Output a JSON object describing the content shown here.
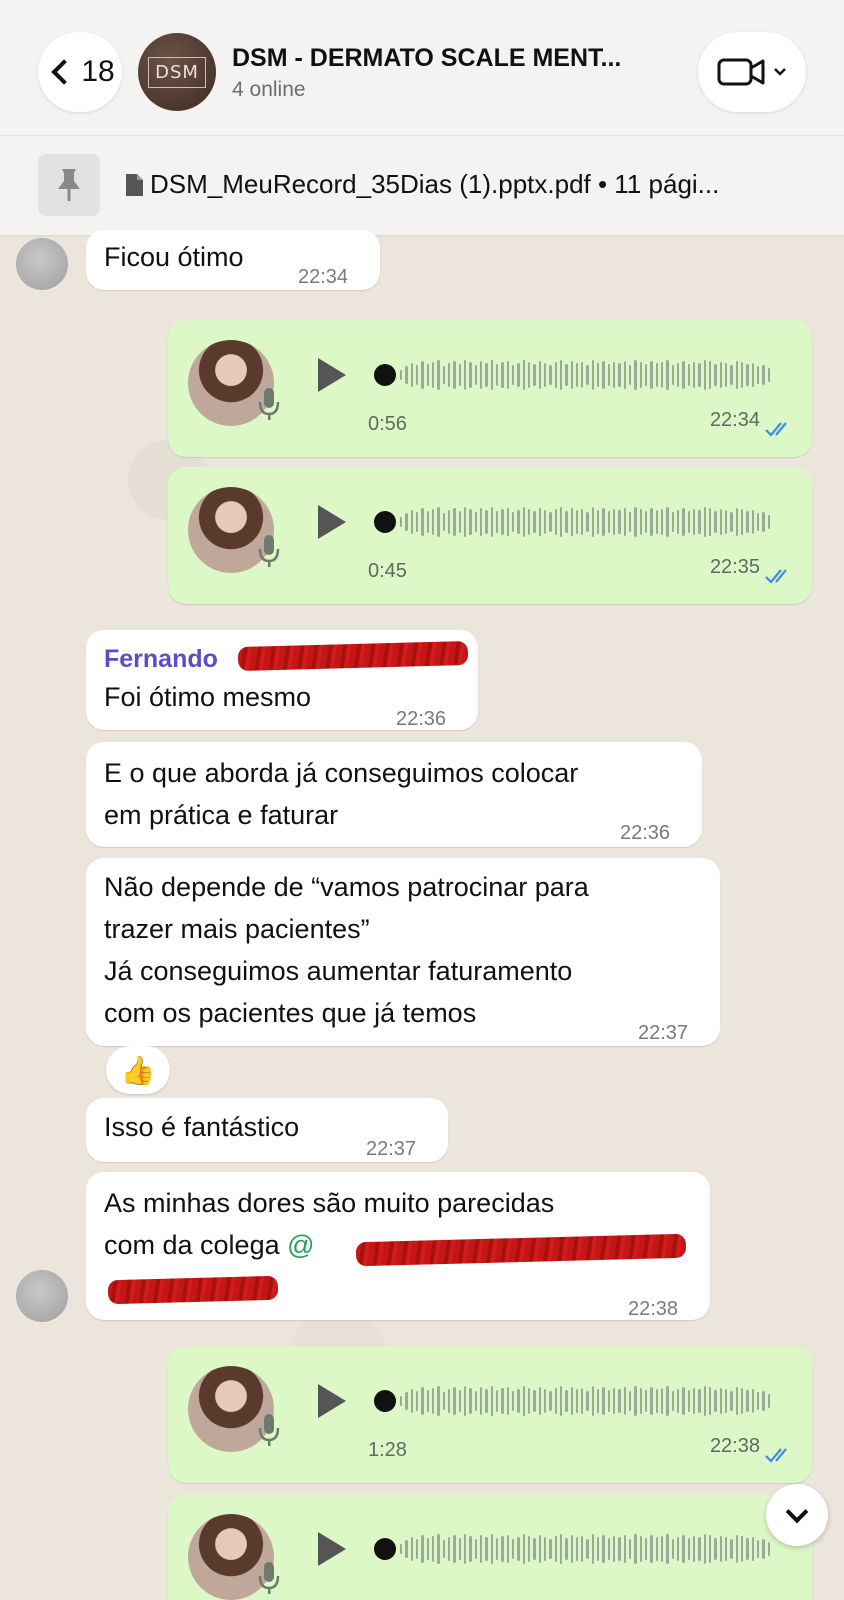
{
  "header": {
    "back_count": "18",
    "title": "DSM - DERMATO SCALE MENT...",
    "subtitle": "4 online",
    "avatar_text": "DSM"
  },
  "pinned": {
    "file_label": "DSM_MeuRecord_35Dias (1).pptx.pdf • 11 pági..."
  },
  "messages": [
    {
      "text": "Ficou ótimo",
      "time": "22:34"
    },
    {
      "voice_duration": "0:56",
      "time": "22:34"
    },
    {
      "voice_duration": "0:45",
      "time": "22:35"
    },
    {
      "sender": "Fernando",
      "text": "Foi ótimo mesmo",
      "time": "22:36"
    },
    {
      "text": "E o que aborda já conseguimos colocar\nem prática e faturar",
      "time": "22:36"
    },
    {
      "text": "Não depende de “vamos patrocinar para\ntrazer mais pacientes”\nJá conseguimos aumentar faturamento\ncom os pacientes que já temos",
      "time": "22:37"
    },
    {
      "reaction": "👍"
    },
    {
      "text": "Isso é fantástico",
      "time": "22:37"
    },
    {
      "text_line1": "As minhas dores são muito parecidas",
      "text_line2": "com da colega",
      "mention_prefix": "@",
      "time": "22:38"
    },
    {
      "voice_duration": "1:28",
      "time": "22:38"
    },
    {
      "voice_duration": "",
      "time": ""
    }
  ],
  "colors": {
    "outgoing_bubble": "#dcf8c6",
    "incoming_bubble": "#ffffff",
    "sender_name": "#5a4dc7",
    "read_ticks": "#3b8ee6",
    "redaction": "#c51616"
  }
}
